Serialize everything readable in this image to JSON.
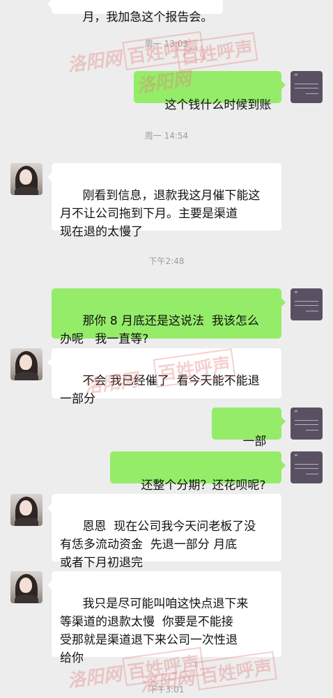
{
  "messages": {
    "prev_partial": "月，我加急这个报告会。",
    "m1": "这个钱什么时候到账",
    "m2": "刚看到信息，退款我这月催下能这\n月不让公司拖到下月。主要是渠道\n现在退的太慢了",
    "m3": "那你 8 月底还是这说法  我该怎么\n办呢   我一直等?",
    "m4": "不会 我已经催了  看今天能不能退\n一部分",
    "m5": "一部分?",
    "m6": "还整个分期？还花呗呢?",
    "m7": "恩恩  现在公司我今天问老板了没\n有恁多流动资金  先退一部分 月底\n或者下月初退完",
    "m8": "我只是尽可能叫咱这快点退下来\n等渠道的退款太慢  你要是不能接\n受那就是渠道退下来公司一次性退\n给你"
  },
  "timestamps": {
    "t1": "周一 13:03",
    "t2": "周一 14:54",
    "t3": "下午2:48",
    "t4": "下午3:01"
  },
  "watermarks": {
    "site": "洛阳网",
    "stamp": "百姓呼声"
  },
  "icons": {
    "contact_avatar": "woman-portrait-avatar",
    "self_avatar": "quote-text-avatar"
  },
  "colors": {
    "background": "#ededed",
    "outgoing_bubble": "#95ec69",
    "incoming_bubble": "#ffffff"
  }
}
